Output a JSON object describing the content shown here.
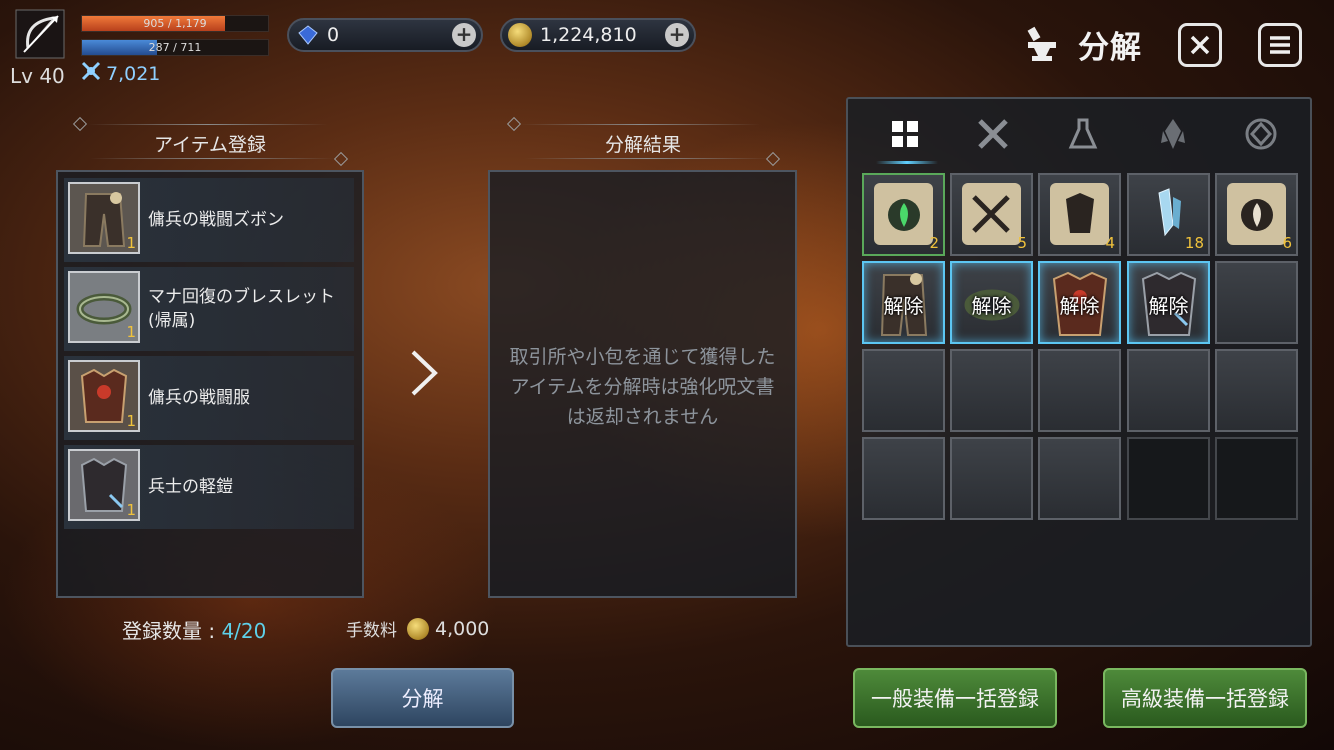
{
  "player": {
    "hp_text": "905 / 1,179",
    "hp_fraction": 0.768,
    "mp_text": "287 / 711",
    "mp_fraction": 0.404,
    "level": "Lv 40",
    "combat_power": "7,021"
  },
  "currency": {
    "gems": "0",
    "gold": "1,224,810"
  },
  "header": {
    "title": "分解",
    "icons": [
      "anvil-icon",
      "close-icon",
      "menu-icon"
    ]
  },
  "register_panel": {
    "title": "アイテム登録",
    "items": [
      {
        "name": "傭兵の戦闘ズボン",
        "qty": "1"
      },
      {
        "name": "マナ回復のブレスレット(帰属)",
        "qty": "1"
      },
      {
        "name": "傭兵の戦闘服",
        "qty": "1"
      },
      {
        "name": "兵士の軽鎧",
        "qty": "1"
      }
    ],
    "count_label": "登録数量 : ",
    "count_value": "4/20"
  },
  "result_panel": {
    "title": "分解結果",
    "hint_line1": "取引所や小包を通じて獲得した",
    "hint_line2": "アイテムを分解時は強化呪文書",
    "hint_line3": "は返却されません"
  },
  "fee": {
    "label": "手数料",
    "amount": "4,000"
  },
  "inventory": {
    "tabs": [
      "grid-icon",
      "swords-icon",
      "flask-icon",
      "crystal-icon",
      "rune-icon"
    ],
    "row1": [
      {
        "icon": "scroll-green-icon",
        "qty": "2"
      },
      {
        "icon": "scroll-weapon-icon",
        "qty": "5"
      },
      {
        "icon": "scroll-armor-icon",
        "qty": "4"
      },
      {
        "icon": "crystal-shard-icon",
        "qty": "18"
      },
      {
        "icon": "scroll-flame-icon",
        "qty": "6"
      }
    ],
    "remove_label": "解除"
  },
  "buttons": {
    "disassemble": "分解",
    "register_normal": "一般装備一括登録",
    "register_high": "高級装備一括登録"
  },
  "colors": {
    "hp": "#e0602a",
    "mp": "#3a78c8",
    "accent_cyan": "#5ed0e8",
    "qty_gold": "#f0c23c",
    "green_button": "#4e8a3a"
  }
}
